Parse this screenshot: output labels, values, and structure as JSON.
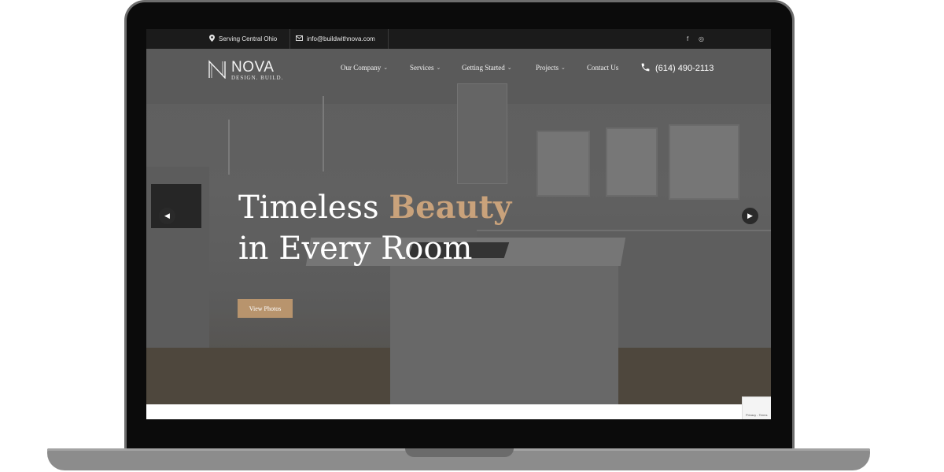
{
  "topbar": {
    "location": "Serving Central Ohio",
    "email": "info@buildwithnova.com",
    "social": [
      "f",
      "◎"
    ]
  },
  "brand": {
    "name": "NOVA",
    "tagline": "DESIGN. BUILD."
  },
  "nav": {
    "items": [
      {
        "label": "Our Company"
      },
      {
        "label": "Services"
      },
      {
        "label": "Getting Started"
      },
      {
        "label": "Projects"
      },
      {
        "label": "Contact Us"
      }
    ],
    "phone": "(614) 490-2113"
  },
  "hero": {
    "headline_line1_start": "Timeless ",
    "headline_line1_accent": "Beauty",
    "headline_line2": "in Every Room",
    "cta_label": "View Photos"
  },
  "recaptcha": {
    "text": "Privacy - Terms"
  },
  "colors": {
    "accent": "#c9a27b",
    "button": "#b8946d",
    "topbar": "#1b1b1b"
  },
  "icons": {
    "location": "map-pin-icon",
    "email": "envelope-icon",
    "phone": "phone-icon",
    "prev": "chevron-left-icon",
    "next": "chevron-right-icon"
  }
}
